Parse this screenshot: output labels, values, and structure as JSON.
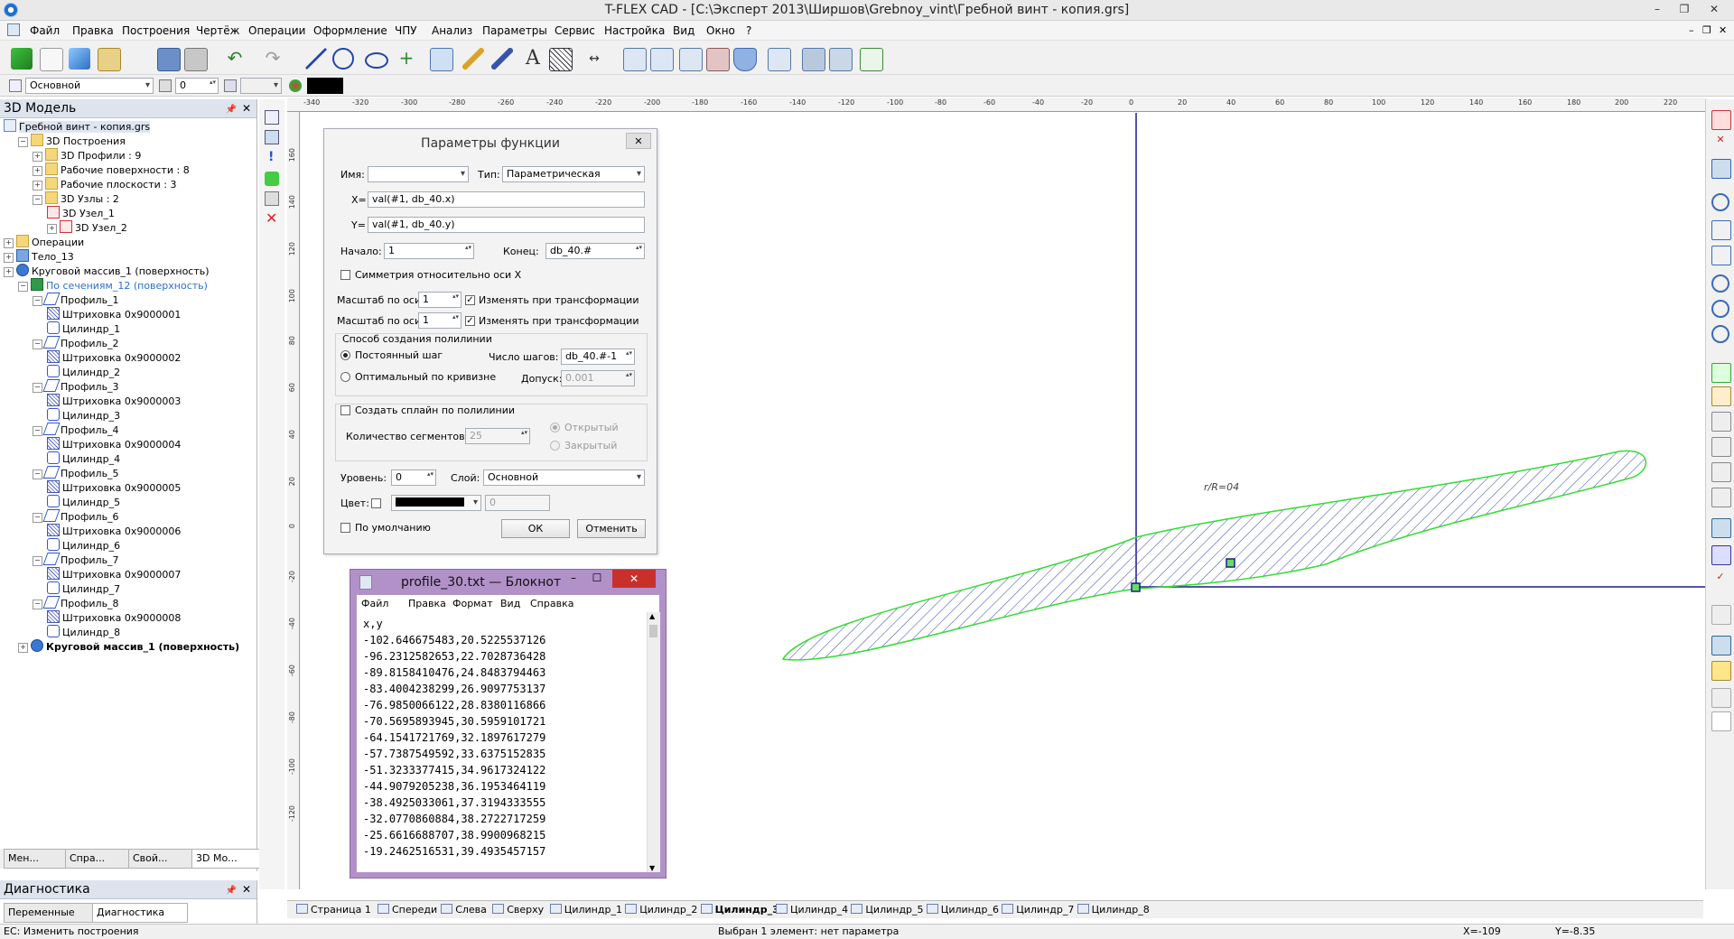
{
  "window": {
    "title": "T-FLEX CAD - [C:\\Эксперт 2013\\Ширшов\\Grebnoy_vint\\Гребной винт - копия.grs]",
    "minimize": "–",
    "restore": "❐",
    "close": "✕"
  },
  "menu": [
    "Файл",
    "Правка",
    "Построения",
    "Чертёж",
    "Операции",
    "Оформление",
    "ЧПУ",
    "Анализ",
    "Параметры",
    "Сервис",
    "Настройка",
    "Вид",
    "Окно",
    "?"
  ],
  "toolbar2": {
    "layer": "Основной",
    "level": "0",
    "color_hex": "#000000"
  },
  "left_panel": {
    "title": "3D Модель",
    "tree": [
      {
        "label": "Гребной винт - копия.grs",
        "indent": 0,
        "icon": "doc",
        "exp": ""
      },
      {
        "label": "3D Построения",
        "indent": 1,
        "icon": "folder",
        "exp": "−"
      },
      {
        "label": "3D Профили : 9",
        "indent": 2,
        "icon": "folder",
        "exp": "+"
      },
      {
        "label": "Рабочие поверхности : 8",
        "indent": 2,
        "icon": "folder",
        "exp": "+"
      },
      {
        "label": "Рабочие плоскости : 3",
        "indent": 2,
        "icon": "folder",
        "exp": "+"
      },
      {
        "label": "3D Узлы : 2",
        "indent": 2,
        "icon": "folder",
        "exp": "−"
      },
      {
        "label": "3D Узел_1",
        "indent": 3,
        "icon": "node",
        "exp": ""
      },
      {
        "label": "3D Узел_2",
        "indent": 3,
        "icon": "node",
        "exp": "+"
      },
      {
        "label": "Операции",
        "indent": 0,
        "icon": "folder",
        "exp": "+"
      },
      {
        "label": "Тело_13",
        "indent": 0,
        "icon": "body",
        "exp": "+"
      },
      {
        "label": "Круговой массив_1 (поверхность)",
        "indent": 0,
        "icon": "array",
        "exp": "+"
      },
      {
        "label": "По сечениям_12 (поверхность)",
        "indent": 1,
        "icon": "loft",
        "exp": "−",
        "color": "#2a6fd0"
      },
      {
        "label": "Профиль_1",
        "indent": 2,
        "icon": "prof",
        "exp": "−"
      },
      {
        "label": "Штриховка 0x9000001",
        "indent": 3,
        "icon": "hatch",
        "exp": ""
      },
      {
        "label": "Цилиндр_1",
        "indent": 3,
        "icon": "cyl",
        "exp": ""
      },
      {
        "label": "Профиль_2",
        "indent": 2,
        "icon": "prof",
        "exp": "−"
      },
      {
        "label": "Штриховка 0x9000002",
        "indent": 3,
        "icon": "hatch",
        "exp": ""
      },
      {
        "label": "Цилиндр_2",
        "indent": 3,
        "icon": "cyl",
        "exp": ""
      },
      {
        "label": "Профиль_3",
        "indent": 2,
        "icon": "prof",
        "exp": "−"
      },
      {
        "label": "Штриховка 0x9000003",
        "indent": 3,
        "icon": "hatch",
        "exp": ""
      },
      {
        "label": "Цилиндр_3",
        "indent": 3,
        "icon": "cyl",
        "exp": ""
      },
      {
        "label": "Профиль_4",
        "indent": 2,
        "icon": "prof",
        "exp": "−"
      },
      {
        "label": "Штриховка 0x9000004",
        "indent": 3,
        "icon": "hatch",
        "exp": ""
      },
      {
        "label": "Цилиндр_4",
        "indent": 3,
        "icon": "cyl",
        "exp": ""
      },
      {
        "label": "Профиль_5",
        "indent": 2,
        "icon": "prof",
        "exp": "−"
      },
      {
        "label": "Штриховка 0x9000005",
        "indent": 3,
        "icon": "hatch",
        "exp": ""
      },
      {
        "label": "Цилиндр_5",
        "indent": 3,
        "icon": "cyl",
        "exp": ""
      },
      {
        "label": "Профиль_6",
        "indent": 2,
        "icon": "prof",
        "exp": "−"
      },
      {
        "label": "Штриховка 0x9000006",
        "indent": 3,
        "icon": "hatch",
        "exp": ""
      },
      {
        "label": "Цилиндр_6",
        "indent": 3,
        "icon": "cyl",
        "exp": ""
      },
      {
        "label": "Профиль_7",
        "indent": 2,
        "icon": "prof",
        "exp": "−"
      },
      {
        "label": "Штриховка 0x9000007",
        "indent": 3,
        "icon": "hatch",
        "exp": ""
      },
      {
        "label": "Цилиндр_7",
        "indent": 3,
        "icon": "cyl",
        "exp": ""
      },
      {
        "label": "Профиль_8",
        "indent": 2,
        "icon": "prof",
        "exp": "−"
      },
      {
        "label": "Штриховка 0x9000008",
        "indent": 3,
        "icon": "hatch",
        "exp": ""
      },
      {
        "label": "Цилиндр_8",
        "indent": 3,
        "icon": "cyl",
        "exp": ""
      },
      {
        "label": "Круговой массив_1 (поверхность)",
        "indent": 1,
        "icon": "array",
        "exp": "+",
        "bold": true
      }
    ],
    "tabs": [
      "Мен...",
      "Спра...",
      "Свой...",
      "3D Мо..."
    ]
  },
  "diag_panel": {
    "title": "Диагностика",
    "tabs": [
      "Переменные",
      "Диагностика"
    ]
  },
  "ruler": {
    "top_ticks": [
      "-340",
      "-320",
      "-300",
      "-280",
      "-260",
      "-240",
      "-220",
      "-200",
      "-180",
      "-160",
      "-140",
      "-120",
      "-100",
      "-80",
      "-60",
      "-40",
      "-20",
      "0",
      "20",
      "40",
      "60",
      "80",
      "100",
      "120",
      "140",
      "160",
      "180",
      "200",
      "220"
    ],
    "left_ticks": [
      "160",
      "140",
      "120",
      "100",
      "80",
      "60",
      "40",
      "20",
      "0",
      "-20",
      "-40",
      "-60",
      "-80",
      "-100",
      "-120"
    ]
  },
  "drawing": {
    "annotation": "r/R=04",
    "hatch_color": "#3344aa",
    "outline_color": "#33dd33",
    "axis_color": "#1a1a8c"
  },
  "dialog": {
    "title": "Параметры функции",
    "name_label": "Имя:",
    "name_value": "",
    "type_label": "Тип:",
    "type_value": "Параметрическая",
    "x_label": "X=",
    "x_value": "val(#1, db_40.x)",
    "y_label": "Y=",
    "y_value": "val(#1, db_40.y)",
    "start_label": "Начало:",
    "start_value": "1",
    "end_label": "Конец:",
    "end_value": "db_40.#",
    "symmetry_label": "Симметрия относительно оси X",
    "symmetry_checked": false,
    "scale_x_label": "Масштаб по оси X:",
    "scale_x_value": "1",
    "scale_y_label": "Масштаб по оси Y:",
    "scale_y_value": "1",
    "transform_label": "Изменять при трансформации",
    "transform_x_checked": true,
    "transform_y_checked": true,
    "polyline_group": "Способ создания полилинии",
    "const_step": "Постоянный шаг",
    "steps_label": "Число шагов:",
    "steps_value": "db_40.#-1",
    "optimal": "Оптимальный по кривизне",
    "tolerance_label": "Допуск:",
    "tolerance_value": "0.001",
    "spline_label": "Создать сплайн по полилинии",
    "spline_checked": false,
    "segments_label": "Количество сегментов:",
    "segments_value": "25",
    "open_label": "Открытый",
    "closed_label": "Закрытый",
    "level_label": "Уровень:",
    "level_value": "0",
    "layer_label": "Слой:",
    "layer_value": "Основной",
    "color_label": "Цвет:",
    "color_value_hex": "#000000",
    "color_num": "0",
    "default_label": "По умолчанию",
    "ok": "ОК",
    "cancel": "Отменить",
    "close": "✕"
  },
  "notepad": {
    "title": "profile_30.txt — Блокнот",
    "menu": [
      "Файл",
      "Правка",
      "Формат",
      "Вид",
      "Справка"
    ],
    "lines": [
      "x,y",
      "-102.646675483,20.5225537126",
      "-96.2312582653,22.7028736428",
      "-89.8158410476,24.8483794463",
      "-83.4004238299,26.9097753137",
      "-76.9850066122,28.8380116866",
      "-70.5695893945,30.5959101721",
      "-64.1541721769,32.1897617279",
      "-57.7387549592,33.6375152835",
      "-51.3233377415,34.9617324122",
      "-44.9079205238,36.1953464119",
      "-38.4925033061,37.3194333555",
      "-32.0770860884,38.2722717259",
      "-25.6616688707,38.9900968215",
      "-19.2462516531,39.4935457157"
    ],
    "minimize": "–",
    "maximize": "☐",
    "close": "✕"
  },
  "page_tabs": [
    "Страница 1",
    "Спереди",
    "Слева",
    "Сверху",
    "Цилиндр_1",
    "Цилиндр_2",
    "Цилиндр_3",
    "Цилиндр_4",
    "Цилиндр_5",
    "Цилиндр_6",
    "Цилиндр_7",
    "Цилиндр_8"
  ],
  "page_tabs_active": "Цилиндр_3",
  "status": {
    "left": "EC: Изменить построения",
    "center": "Выбран 1 элемент: нет параметра",
    "x": "X=-109",
    "y": "Y=-8.35"
  }
}
